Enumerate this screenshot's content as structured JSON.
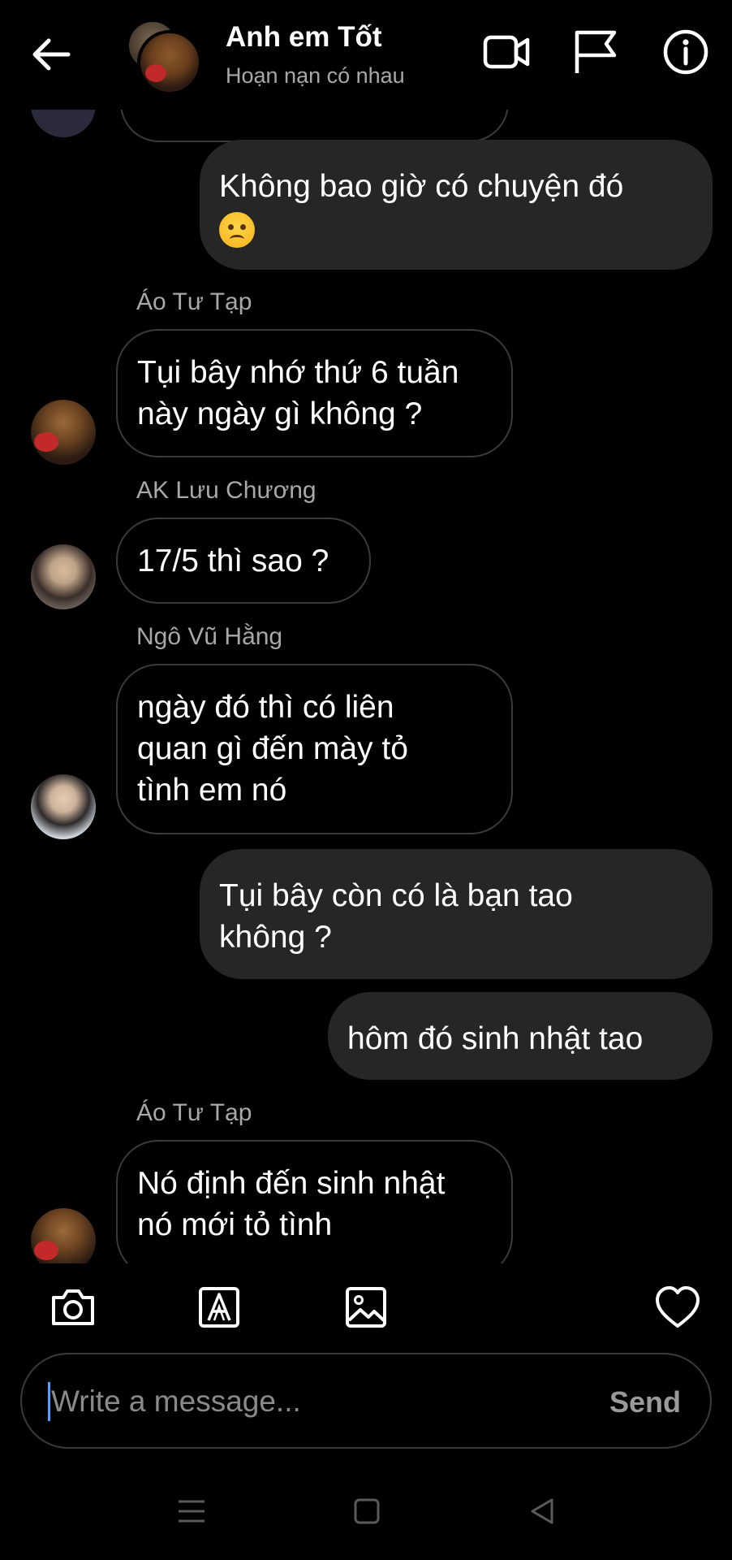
{
  "header": {
    "title": "Anh em Tốt",
    "subtitle": "Hoạn nạn có nhau",
    "icons": [
      "back-arrow-icon",
      "video-call-icon",
      "flag-icon",
      "info-icon"
    ]
  },
  "messages": [
    {
      "type": "out",
      "text": "Không bao giờ có chuyện đó"
    },
    {
      "type": "in",
      "sender": "Áo Tư Tạp",
      "lines": [
        "Tụi bây nhớ thứ 6 tuần",
        "này ngày gì không ?"
      ]
    },
    {
      "type": "in",
      "sender": "AK Lưu Chương",
      "lines": [
        "17/5 thì sao ?"
      ]
    },
    {
      "type": "in",
      "sender": "Ngô Vũ Hằng",
      "lines": [
        "ngày đó thì có liên",
        "quan gì đến mày tỏ",
        "tình em nó"
      ]
    },
    {
      "type": "out",
      "lines": [
        "Tụi bây còn có là bạn tao",
        "không ?"
      ]
    },
    {
      "type": "out",
      "lines": [
        "hôm đó sinh nhật tao"
      ]
    },
    {
      "type": "in",
      "sender": "Áo Tư Tạp",
      "lines": [
        "Nó định đến sinh nhật",
        "nó mới tỏ tình"
      ]
    }
  ],
  "toolbar": {
    "icons": [
      "camera-icon",
      "text-style-icon",
      "gallery-icon",
      "heart-icon"
    ]
  },
  "composer": {
    "placeholder": "Write a message...",
    "value": "",
    "send_label": "Send"
  },
  "navbar": {
    "icons": [
      "recent-apps-icon",
      "home-icon",
      "back-icon"
    ]
  },
  "colors": {
    "background": "#000000",
    "outgoing_bubble": "#262626",
    "incoming_border": "#3a3a3a",
    "muted_text": "#a8a8a8",
    "caret": "#4aa3ff"
  }
}
